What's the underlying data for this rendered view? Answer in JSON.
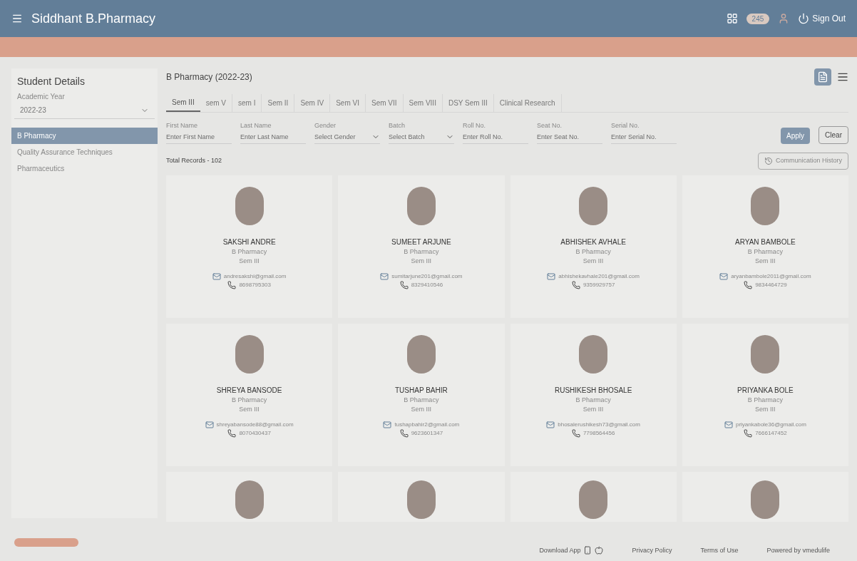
{
  "header": {
    "title": "Siddhant B.Pharmacy",
    "badge": "245",
    "sign_out": "Sign Out"
  },
  "sidebar": {
    "title": "Student Details",
    "year_label": "Academic Year",
    "year_value": "2022-23",
    "items": [
      {
        "label": "B Pharmacy",
        "selected": true
      },
      {
        "label": "Quality Assurance Techniques",
        "selected": false
      },
      {
        "label": "Pharmaceutics",
        "selected": false
      }
    ]
  },
  "main": {
    "title": "B Pharmacy (2022-23)",
    "tabs": [
      {
        "label": "Sem III",
        "selected": true
      },
      {
        "label": "sem V",
        "selected": false
      },
      {
        "label": "sem I",
        "selected": false
      },
      {
        "label": "Sem II",
        "selected": false
      },
      {
        "label": "Sem IV",
        "selected": false
      },
      {
        "label": "Sem VI",
        "selected": false
      },
      {
        "label": "Sem VII",
        "selected": false
      },
      {
        "label": "Sem VIII",
        "selected": false
      },
      {
        "label": "DSY Sem III",
        "selected": false
      },
      {
        "label": "Clinical Research",
        "selected": false
      }
    ],
    "filters": [
      {
        "label": "First Name",
        "placeholder": "Enter First Name",
        "kind": "text"
      },
      {
        "label": "Last Name",
        "placeholder": "Enter Last Name",
        "kind": "text"
      },
      {
        "label": "Gender",
        "placeholder": "Select Gender",
        "kind": "select"
      },
      {
        "label": "Batch",
        "placeholder": "Select Batch",
        "kind": "select"
      },
      {
        "label": "Roll No.",
        "placeholder": "Enter Roll No.",
        "kind": "text"
      },
      {
        "label": "Seat No.",
        "placeholder": "Enter Seat No.",
        "kind": "text"
      },
      {
        "label": "Serial No.",
        "placeholder": "Enter Serial No.",
        "kind": "text"
      }
    ],
    "apply": "Apply",
    "clear": "Clear",
    "total": "Total Records - 102",
    "history": "Communication History",
    "students": [
      {
        "name": "SAKSHI ANDRE",
        "course": "B Pharmacy",
        "sem": "Sem III",
        "email": "andresakshi@gmail.com",
        "phone": "8698795303"
      },
      {
        "name": "SUMEET ARJUNE",
        "course": "B Pharmacy",
        "sem": "Sem III",
        "email": "sumitarjune201@gmail.com",
        "phone": "8329410546"
      },
      {
        "name": "ABHISHEK AVHALE",
        "course": "B Pharmacy",
        "sem": "Sem III",
        "email": "abhishekavhale201@gmail.com",
        "phone": "9359929757"
      },
      {
        "name": "ARYAN BAMBOLE",
        "course": "B Pharmacy",
        "sem": "Sem III",
        "email": "aryanbambole2011@gmail.com",
        "phone": "9834464729"
      },
      {
        "name": "SHREYA BANSODE",
        "course": "B Pharmacy",
        "sem": "Sem III",
        "email": "shreyabansode88@gmail.com",
        "phone": "8070430437"
      },
      {
        "name": "TUSHAP BAHIR",
        "course": "B Pharmacy",
        "sem": "Sem III",
        "email": "tushapbahir2@gmail.com",
        "phone": "9623601347"
      },
      {
        "name": "RUSHIKESH BHOSALE",
        "course": "B Pharmacy",
        "sem": "Sem III",
        "email": "bhosalerushikesh73@gmail.com",
        "phone": "7798564456"
      },
      {
        "name": "PRIYANKA BOLE",
        "course": "B Pharmacy",
        "sem": "Sem III",
        "email": "priyankabole36@gmail.com",
        "phone": "7666147452"
      }
    ]
  },
  "footer": {
    "download": "Download App",
    "privacy": "Privacy Policy",
    "terms": "Terms of Use",
    "powered": "Powered by vmedulife"
  }
}
